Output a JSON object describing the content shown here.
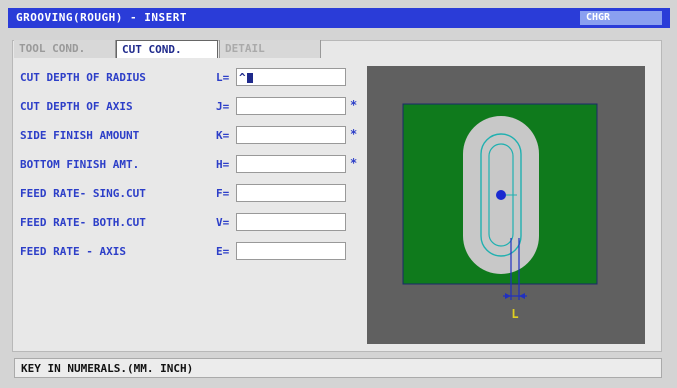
{
  "window": {
    "title": "GROOVING(ROUGH) - INSERT",
    "mode": "CHGR"
  },
  "tabs": [
    {
      "label": "TOOL COND."
    },
    {
      "label": "CUT COND."
    },
    {
      "label": "DETAIL"
    }
  ],
  "fields": [
    {
      "label": "CUT DEPTH OF RADIUS",
      "code": "L=",
      "value": "^",
      "marker": ""
    },
    {
      "label": "CUT DEPTH OF AXIS",
      "code": "J=",
      "value": "",
      "marker": "*"
    },
    {
      "label": "SIDE FINISH AMOUNT",
      "code": "K=",
      "value": "",
      "marker": "*"
    },
    {
      "label": "BOTTOM FINISH AMT.",
      "code": "H=",
      "value": "",
      "marker": "*"
    },
    {
      "label": "FEED RATE- SING.CUT",
      "code": "F=",
      "value": "",
      "marker": ""
    },
    {
      "label": "FEED RATE- BOTH.CUT",
      "code": "V=",
      "value": "",
      "marker": ""
    },
    {
      "label": "FEED RATE - AXIS",
      "code": "E=",
      "value": "",
      "marker": ""
    }
  ],
  "diagram": {
    "dimension_label": "L",
    "colors": {
      "background": "#606060",
      "workpiece": "#0f7a1c",
      "groove": "#c8c8c8",
      "toolpath": "#20b0b0",
      "center_point": "#1a2ad0",
      "dimension": "#2030c0",
      "label": "#e0d020"
    }
  },
  "status": {
    "message": "KEY IN NUMERALS.(MM. INCH)"
  }
}
